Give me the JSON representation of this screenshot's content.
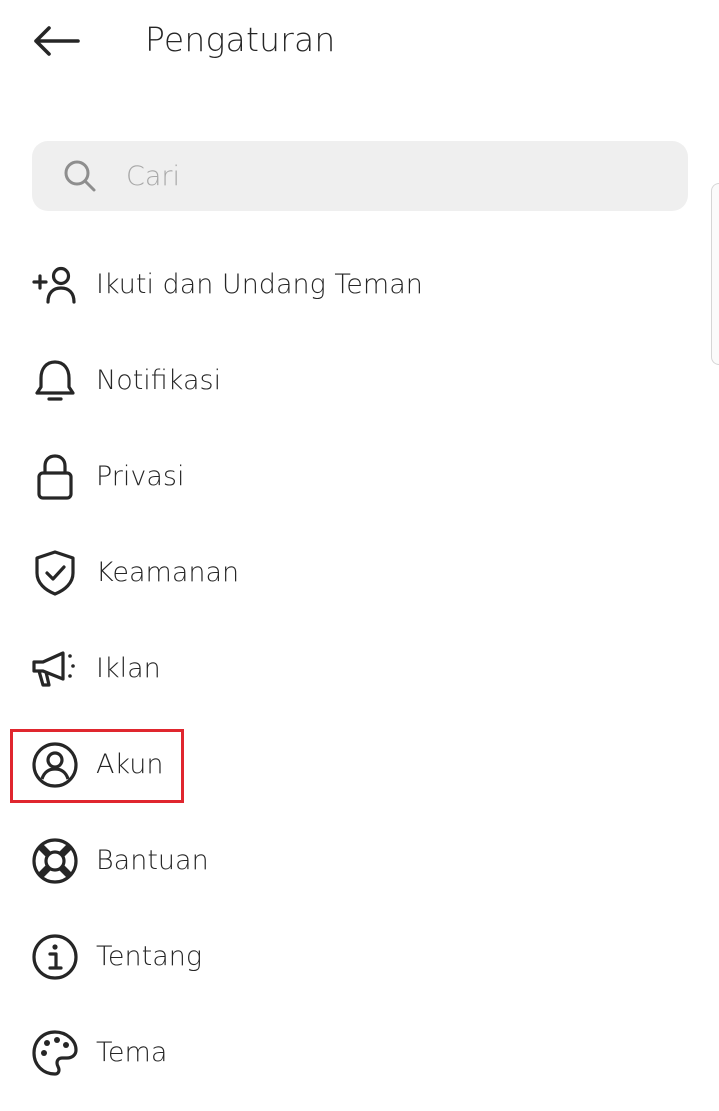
{
  "header": {
    "title": "Pengaturan"
  },
  "search": {
    "placeholder": "Cari",
    "value": ""
  },
  "menu": {
    "items": [
      {
        "label": "Ikuti dan Undang Teman",
        "icon": "add-person-icon"
      },
      {
        "label": "Notifikasi",
        "icon": "bell-icon"
      },
      {
        "label": "Privasi",
        "icon": "lock-icon"
      },
      {
        "label": "Keamanan",
        "icon": "shield-check-icon"
      },
      {
        "label": "Iklan",
        "icon": "megaphone-icon"
      },
      {
        "label": "Akun",
        "icon": "account-circle-icon",
        "highlighted": true
      },
      {
        "label": "Bantuan",
        "icon": "lifebuoy-icon"
      },
      {
        "label": "Tentang",
        "icon": "info-icon"
      },
      {
        "label": "Tema",
        "icon": "palette-icon"
      }
    ]
  },
  "colors": {
    "text": "#262626",
    "placeholder": "#a8a8a8",
    "search_bg": "#efefef",
    "highlight_border": "#e0262e"
  }
}
